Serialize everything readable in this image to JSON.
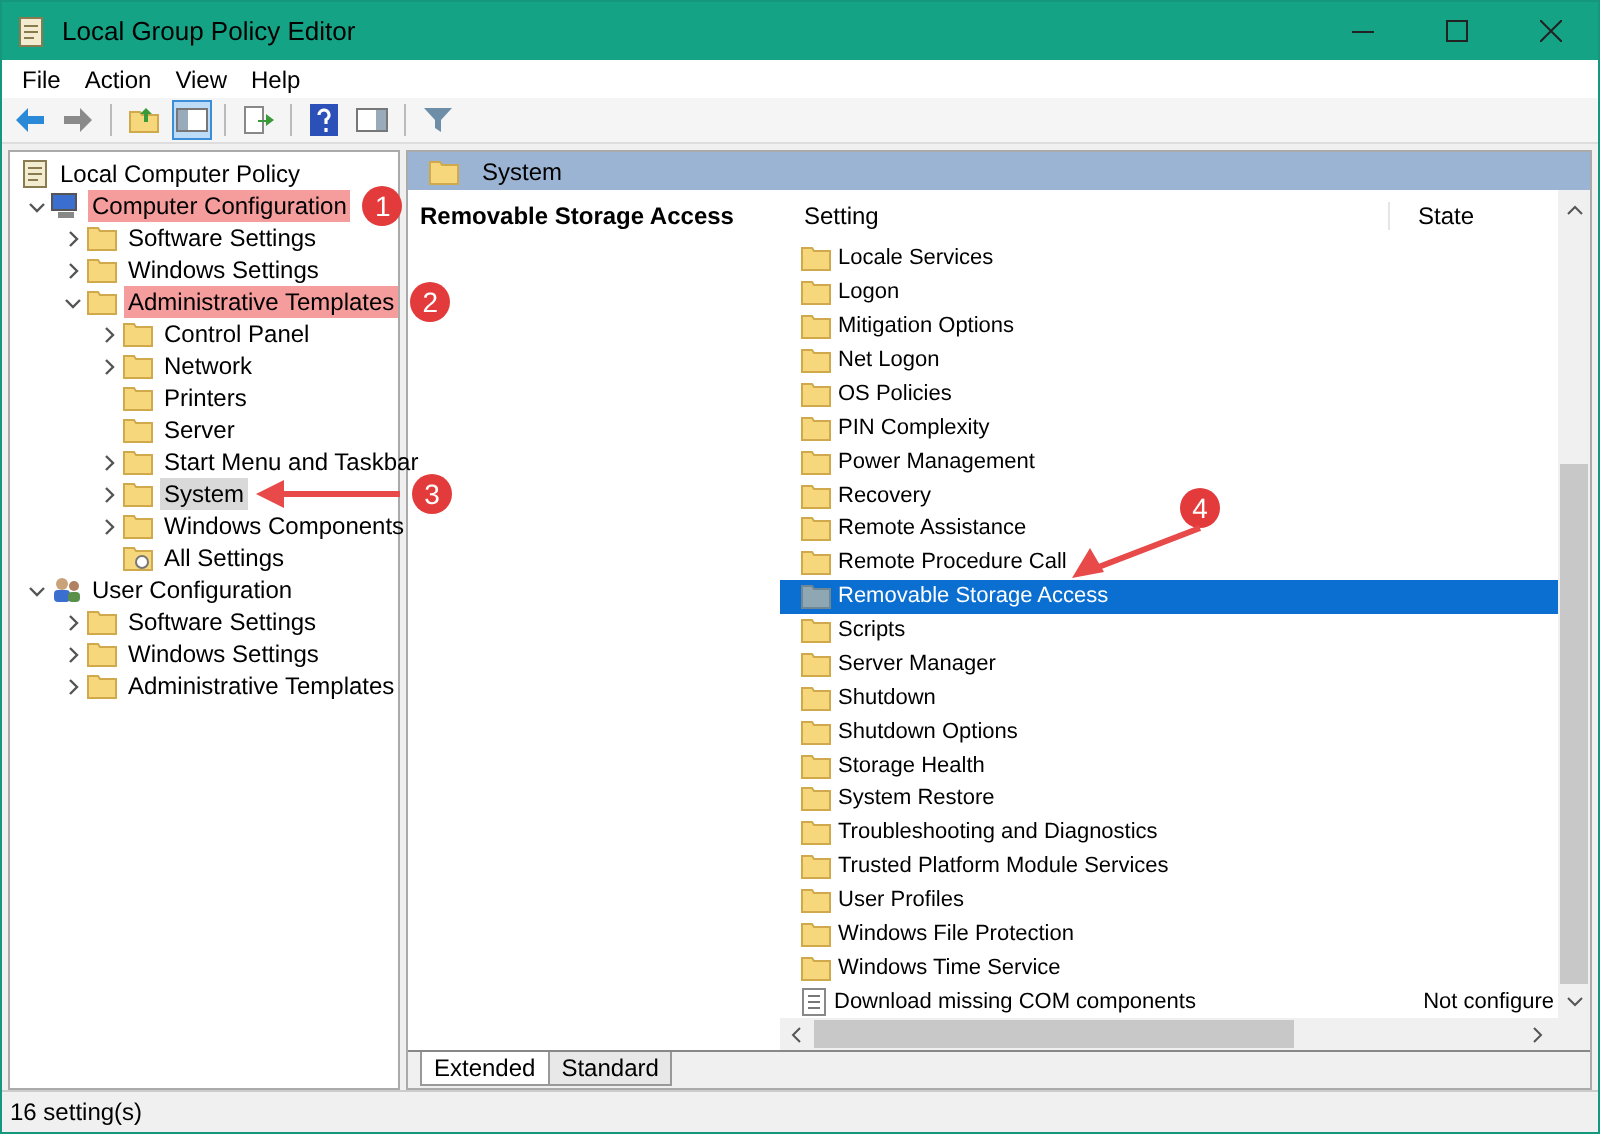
{
  "window": {
    "title": "Local Group Policy Editor"
  },
  "menu": [
    "File",
    "Action",
    "View",
    "Help"
  ],
  "toolbar": [
    [
      {
        "kind": "back",
        "pressed": false
      },
      {
        "kind": "forward",
        "pressed": false
      }
    ],
    [
      {
        "kind": "up",
        "pressed": false
      },
      {
        "kind": "tree",
        "pressed": true
      }
    ],
    [
      {
        "kind": "export",
        "pressed": false
      }
    ],
    [
      {
        "kind": "help",
        "pressed": false
      },
      {
        "kind": "pane",
        "pressed": false
      }
    ],
    [
      {
        "kind": "filter",
        "pressed": false
      }
    ]
  ],
  "tree": {
    "label": "Local Computer Policy",
    "children": [
      {
        "label": "Computer Configuration",
        "kind": "computer",
        "expanded": true,
        "expandable": true,
        "selected": false,
        "highlighted": true,
        "callout": "1",
        "arrow": false,
        "children": [
          {
            "label": "Software Settings",
            "kind": "folder",
            "expanded": false,
            "expandable": true,
            "selected": false,
            "highlighted": false,
            "arrow": false
          },
          {
            "label": "Windows Settings",
            "kind": "folder",
            "expanded": false,
            "expandable": true,
            "selected": false,
            "highlighted": false,
            "arrow": false
          },
          {
            "label": "Administrative Templates",
            "kind": "folder",
            "expanded": true,
            "expandable": true,
            "selected": false,
            "highlighted": true,
            "callout": "2",
            "arrow": false,
            "children": [
              {
                "label": "Control Panel",
                "kind": "folder",
                "expanded": false,
                "expandable": true,
                "selected": false,
                "highlighted": false,
                "arrow": false
              },
              {
                "label": "Network",
                "kind": "folder",
                "expanded": false,
                "expandable": true,
                "selected": false,
                "highlighted": false,
                "arrow": false
              },
              {
                "label": "Printers",
                "kind": "folder",
                "expanded": false,
                "expandable": false,
                "selected": false,
                "highlighted": false,
                "arrow": false
              },
              {
                "label": "Server",
                "kind": "folder",
                "expanded": false,
                "expandable": false,
                "selected": false,
                "highlighted": false,
                "arrow": false
              },
              {
                "label": "Start Menu and Taskbar",
                "kind": "folder",
                "expanded": false,
                "expandable": true,
                "selected": false,
                "highlighted": false,
                "arrow": false
              },
              {
                "label": "System",
                "kind": "folder",
                "expanded": false,
                "expandable": true,
                "selected": true,
                "highlighted": false,
                "callout": "3",
                "arrow": true
              },
              {
                "label": "Windows Components",
                "kind": "folder",
                "expanded": false,
                "expandable": true,
                "selected": false,
                "highlighted": false,
                "arrow": false
              },
              {
                "label": "All Settings",
                "kind": "settings",
                "expanded": false,
                "expandable": false,
                "selected": false,
                "highlighted": false,
                "arrow": false
              }
            ]
          }
        ]
      },
      {
        "label": "User Configuration",
        "kind": "users",
        "expanded": true,
        "expandable": true,
        "selected": false,
        "highlighted": false,
        "arrow": false,
        "children": [
          {
            "label": "Software Settings",
            "kind": "folder",
            "expanded": false,
            "expandable": true,
            "selected": false,
            "highlighted": false,
            "arrow": false
          },
          {
            "label": "Windows Settings",
            "kind": "folder",
            "expanded": false,
            "expandable": true,
            "selected": false,
            "highlighted": false,
            "arrow": false
          },
          {
            "label": "Administrative Templates",
            "kind": "folder",
            "expanded": false,
            "expandable": true,
            "selected": false,
            "highlighted": false,
            "arrow": false
          }
        ]
      }
    ]
  },
  "details": {
    "header": "System",
    "description_title": "Removable Storage Access",
    "columns": [
      "Setting",
      "State"
    ],
    "rows": [
      {
        "label": "Locale Services",
        "kind": "folder",
        "selected": false
      },
      {
        "label": "Logon",
        "kind": "folder",
        "selected": false
      },
      {
        "label": "Mitigation Options",
        "kind": "folder",
        "selected": false
      },
      {
        "label": "Net Logon",
        "kind": "folder",
        "selected": false
      },
      {
        "label": "OS Policies",
        "kind": "folder",
        "selected": false
      },
      {
        "label": "PIN Complexity",
        "kind": "folder",
        "selected": false
      },
      {
        "label": "Power Management",
        "kind": "folder",
        "selected": false
      },
      {
        "label": "Recovery",
        "kind": "folder",
        "selected": false
      },
      {
        "label": "Remote Assistance",
        "kind": "folder",
        "selected": false
      },
      {
        "label": "Remote Procedure Call",
        "kind": "folder",
        "selected": false
      },
      {
        "label": "Removable Storage Access",
        "kind": "folder",
        "selected": true,
        "callout": "4"
      },
      {
        "label": "Scripts",
        "kind": "folder",
        "selected": false
      },
      {
        "label": "Server Manager",
        "kind": "folder",
        "selected": false
      },
      {
        "label": "Shutdown",
        "kind": "folder",
        "selected": false
      },
      {
        "label": "Shutdown Options",
        "kind": "folder",
        "selected": false
      },
      {
        "label": "Storage Health",
        "kind": "folder",
        "selected": false
      },
      {
        "label": "System Restore",
        "kind": "folder",
        "selected": false
      },
      {
        "label": "Troubleshooting and Diagnostics",
        "kind": "folder",
        "selected": false
      },
      {
        "label": "Trusted Platform Module Services",
        "kind": "folder",
        "selected": false
      },
      {
        "label": "User Profiles",
        "kind": "folder",
        "selected": false
      },
      {
        "label": "Windows File Protection",
        "kind": "folder",
        "selected": false
      },
      {
        "label": "Windows Time Service",
        "kind": "folder",
        "selected": false
      },
      {
        "label": "Download missing COM components",
        "kind": "setting",
        "selected": false,
        "state": "Not configure"
      }
    ],
    "tabs": [
      {
        "label": "Extended",
        "selected": true
      },
      {
        "label": "Standard",
        "selected": false
      }
    ]
  },
  "status_bar": "16 setting(s)"
}
